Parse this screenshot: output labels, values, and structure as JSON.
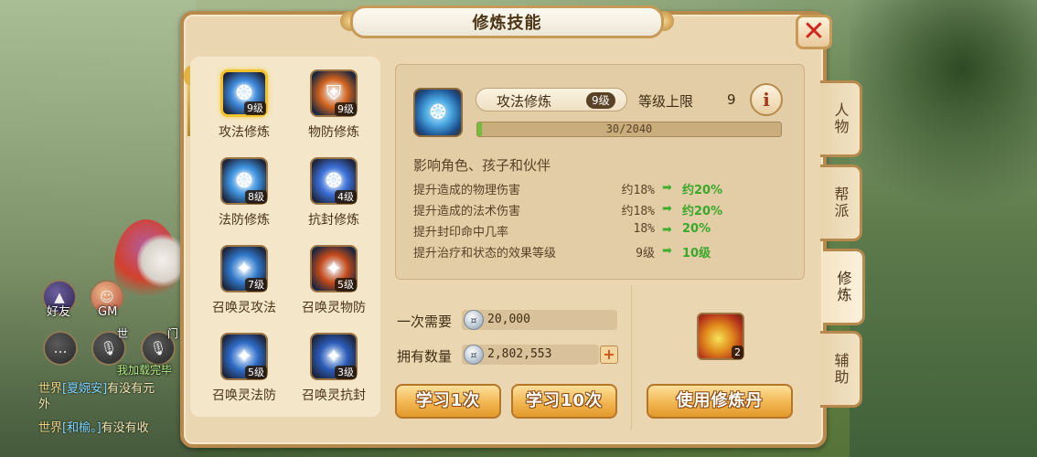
{
  "panel": {
    "title": "修炼技能"
  },
  "skills": [
    {
      "label": "攻法修炼",
      "level": "9级",
      "selected": true,
      "color": "#3d88d8",
      "icon": "swirl-icon"
    },
    {
      "label": "物防修炼",
      "level": "9级",
      "selected": false,
      "color": "#d3641e",
      "icon": "shield-icon"
    },
    {
      "label": "法防修炼",
      "level": "8级",
      "selected": false,
      "color": "#3c92dd",
      "icon": "swirl-icon"
    },
    {
      "label": "抗封修炼",
      "level": "4级",
      "selected": false,
      "color": "#3b6fd6",
      "icon": "swirl-icon"
    },
    {
      "label": "召唤灵攻法",
      "level": "7级",
      "selected": false,
      "color": "#2f77c8",
      "icon": "spirit-icon"
    },
    {
      "label": "召唤灵物防",
      "level": "5级",
      "selected": false,
      "color": "#c44a1a",
      "icon": "spirit-icon"
    },
    {
      "label": "召唤灵法防",
      "level": "5级",
      "selected": false,
      "color": "#2e6bc7",
      "icon": "spirit-icon"
    },
    {
      "label": "召唤灵抗封",
      "level": "3级",
      "selected": false,
      "color": "#2b5bb8",
      "icon": "spirit-icon"
    }
  ],
  "detail": {
    "name": "攻法修炼",
    "level": "9级",
    "cap_label": "等级上限",
    "cap_value": "9",
    "exp_text": "30/2040",
    "exp_fraction": 0.0147,
    "affects": "影响角色、孩子和伙伴",
    "effects": [
      {
        "name": "提升造成的物理伤害",
        "from": "约18%",
        "to": "约20%"
      },
      {
        "name": "提升造成的法术伤害",
        "from": "约18%",
        "to": "约20%"
      },
      {
        "name": "提升封印命中几率",
        "from": "18%",
        "to": "20%"
      },
      {
        "name": "提升治疗和状态的效果等级",
        "from": "9级",
        "to": "10级"
      }
    ]
  },
  "cost": {
    "once_label": "一次需要",
    "once_value": "20,000",
    "owned_label": "拥有数量",
    "owned_value": "2,802,553",
    "plus": "+"
  },
  "pill": {
    "count": "2"
  },
  "buttons": {
    "learn_once": "学习1次",
    "learn_ten": "学习10次",
    "use_pill": "使用修炼丹"
  },
  "tabs": [
    "人物",
    "帮派",
    "修炼",
    "辅助"
  ],
  "hud": {
    "friends": "好友",
    "gm": "GM",
    "world": "世",
    "gate": "门",
    "voice_text": "我加载完毕",
    "chat": [
      {
        "tag": "世界",
        "name": "[夏婉安]",
        "text": "有没有元"
      },
      {
        "tag": "",
        "name": "",
        "text": "外"
      },
      {
        "tag": "世界",
        "name": "[和榆。]",
        "text": "有没有收"
      }
    ]
  }
}
